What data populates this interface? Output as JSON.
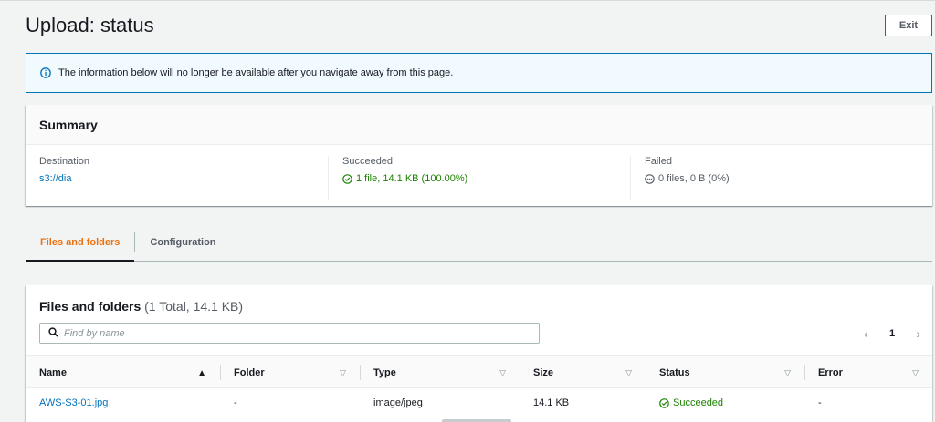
{
  "header": {
    "title": "Upload: status",
    "exit_label": "Exit"
  },
  "banner": {
    "icon": "info-icon",
    "text": "The information below will no longer be available after you navigate away from this page."
  },
  "summary": {
    "title": "Summary",
    "destination": {
      "label": "Destination",
      "value": "s3://dia"
    },
    "succeeded": {
      "label": "Succeeded",
      "value": "1 file, 14.1 KB (100.00%)",
      "icon": "check-circle-icon"
    },
    "failed": {
      "label": "Failed",
      "value": "0 files, 0 B (0%)",
      "icon": "ellipsis-circle-icon"
    }
  },
  "tabs": [
    {
      "label": "Files and folders",
      "active": true
    },
    {
      "label": "Configuration",
      "active": false
    }
  ],
  "files": {
    "title": "Files and folders",
    "count": "(1 Total, 14.1 KB)",
    "search_placeholder": "Find by name",
    "page": "1",
    "columns": [
      "Name",
      "Folder",
      "Type",
      "Size",
      "Status",
      "Error"
    ],
    "rows": [
      {
        "name": "AWS-S3-01.jpg",
        "folder": "-",
        "type": "image/jpeg",
        "size": "14.1 KB",
        "status": "Succeeded",
        "error": "-"
      }
    ]
  },
  "colors": {
    "accent": "#ec7211",
    "link": "#0073bb",
    "success": "#1d8102",
    "info_border": "#0073bb"
  }
}
